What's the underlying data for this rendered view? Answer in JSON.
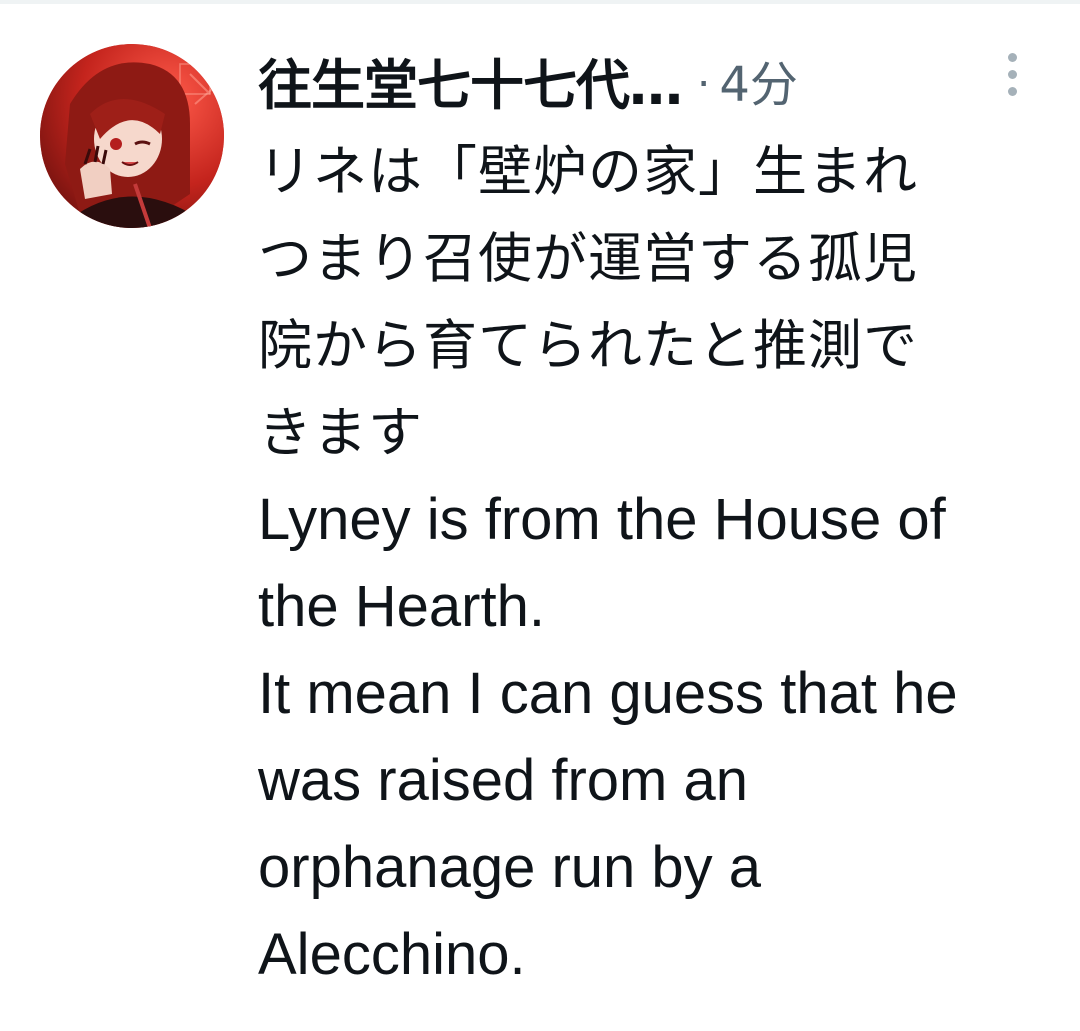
{
  "tweet": {
    "author": {
      "display_name": "往生堂七十七代…",
      "avatar_icon": "user-avatar"
    },
    "separator": "·",
    "timestamp": "4分",
    "more_icon": "more-vertical-icon",
    "text_jp_lines": [
      "リネは「壁炉の家」生まれ",
      "つまり召使が運営する孤児",
      "院から育てられたと推測で",
      "きます"
    ],
    "text_en_lines": [
      "Lyney is from the House of",
      "the Hearth.",
      "It mean I can guess that he",
      "was raised from an",
      "orphanage run by a",
      "Alecchino."
    ]
  },
  "colors": {
    "text_primary": "#0f1419",
    "text_secondary": "#536471",
    "avatar_accent": "#c0302a"
  }
}
